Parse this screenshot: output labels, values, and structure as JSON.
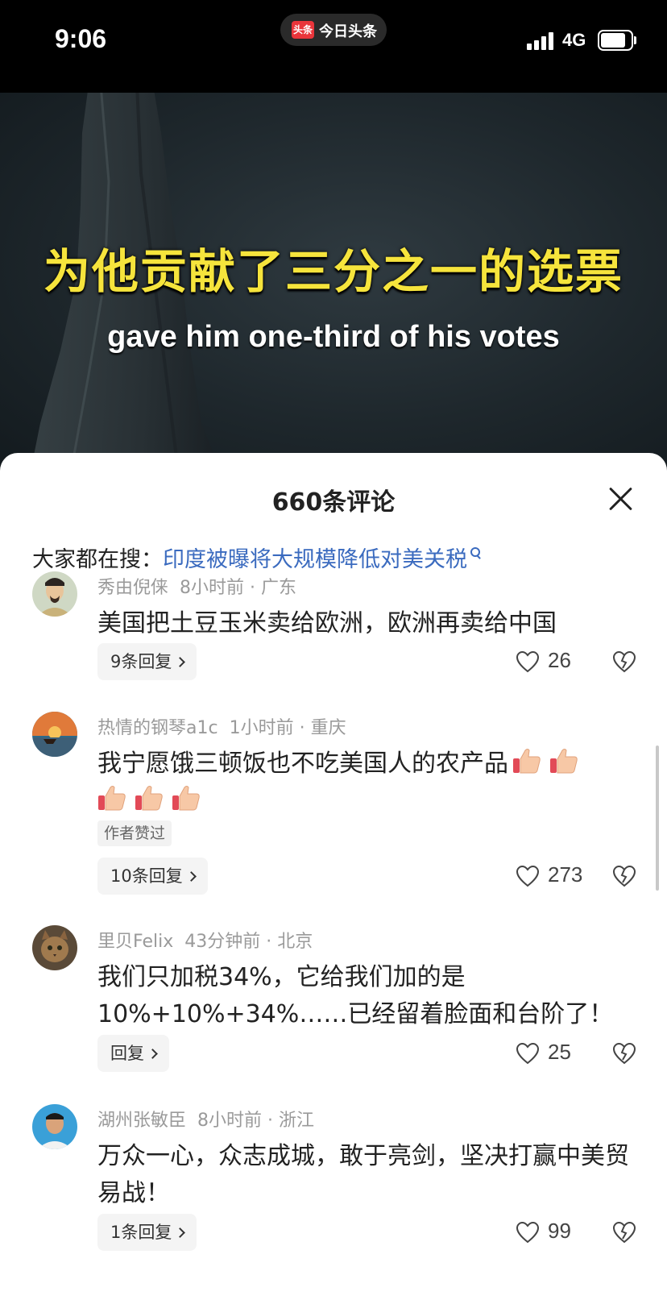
{
  "status_bar": {
    "time": "9:06",
    "app_badge": "头条",
    "app_name": "今日头条",
    "network": "4G"
  },
  "video": {
    "subtitle_cn": "为他贡献了三分之一的选票",
    "subtitle_en": "gave him one-third of his votes"
  },
  "comments_sheet": {
    "title": "660条评论",
    "search_prefix": "大家都在搜：",
    "search_link": "印度被曝将大规模降低对美关税",
    "comments": [
      {
        "user": "秀由倪俫",
        "time": "8小时前",
        "location": "广东",
        "text": "美国把土豆玉米卖给欧洲，欧洲再卖给中国",
        "reply_label": "9条回复",
        "likes": "26"
      },
      {
        "user": "热情的钢琴a1c",
        "time": "1小时前",
        "location": "重庆",
        "text": "我宁愿饿三顿饭也不吃美国人的农产品",
        "author_badge": "作者赞过",
        "reply_label": "10条回复",
        "likes": "273"
      },
      {
        "user": "里贝Felix",
        "time": "43分钟前",
        "location": "北京",
        "text": "我们只加税34%，它给我们加的是10%+10%+34%……已经留着脸面和台阶了！",
        "reply_label": "回复",
        "likes": "25"
      },
      {
        "user": "湖州张敏臣",
        "time": "8小时前",
        "location": "浙江",
        "text": "万众一心，众志成城，敢于亮剑，坚决打赢中美贸易战！",
        "reply_label": "1条回复",
        "likes": "99"
      }
    ]
  },
  "colors": {
    "link": "#3b6bbf",
    "subtitle": "#f6e43c",
    "app_badge": "#e9353b"
  },
  "icons": [
    "signal-icon",
    "battery-icon",
    "close-icon",
    "search-icon",
    "heart-icon",
    "dislike-icon",
    "thumbs-up-emoji"
  ]
}
